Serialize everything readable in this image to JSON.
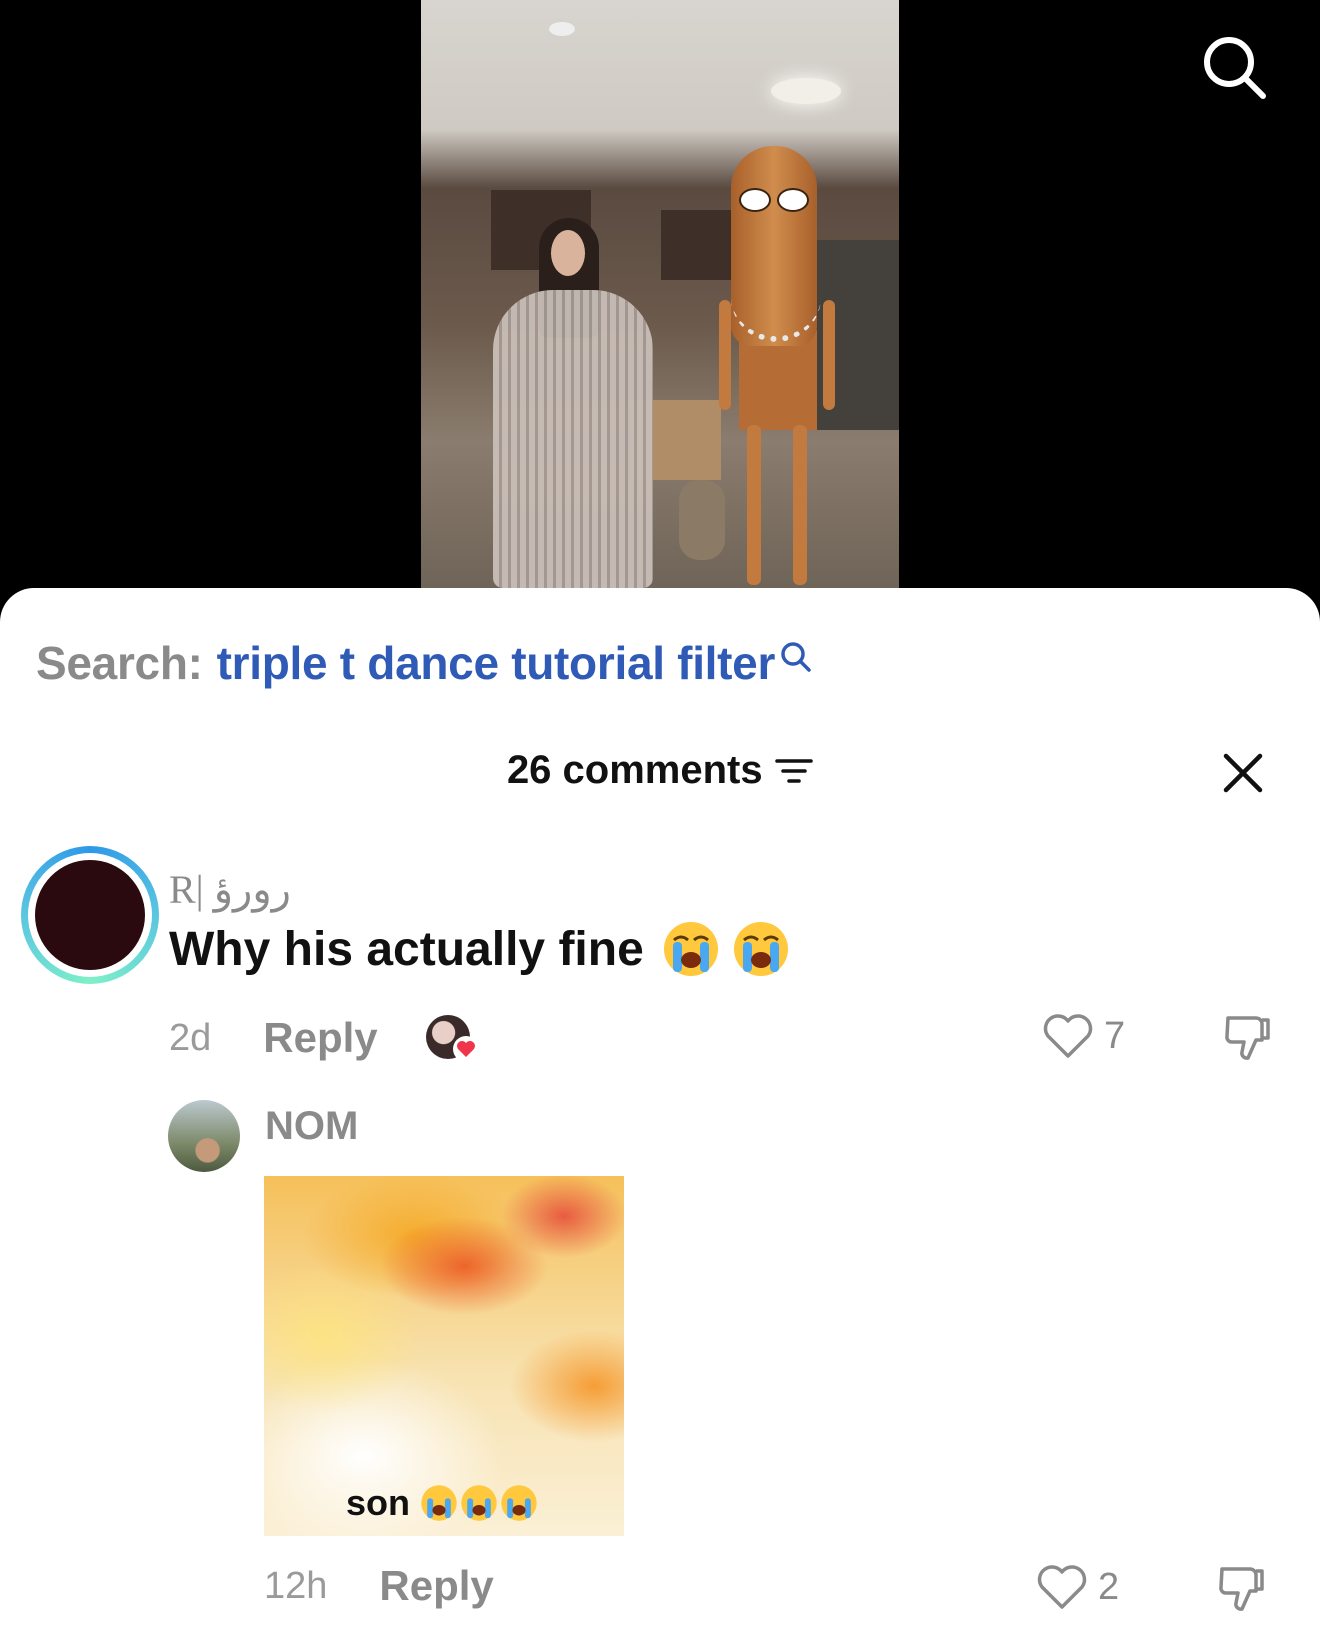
{
  "search_suggestion": {
    "label": "Search:",
    "term": "triple t dance tutorial filter"
  },
  "comments_header": {
    "count_label": "26 comments"
  },
  "comments": [
    {
      "username": "R| رورؤ",
      "text": "Why his actually fine",
      "emojis": [
        "loudly-crying-face",
        "loudly-crying-face"
      ],
      "time": "2d",
      "reply_label": "Reply",
      "likes": "7",
      "liked_by_creator": true
    },
    {
      "username": "NOM",
      "image_caption": "son",
      "image_caption_emojis": [
        "loudly-crying-face",
        "loudly-crying-face",
        "loudly-crying-face"
      ],
      "time": "12h",
      "reply_label": "Reply",
      "likes": "2"
    }
  ],
  "icons": {
    "top_search": "search-icon",
    "sort": "sort-icon",
    "close": "close-icon",
    "like": "heart-outline-icon",
    "dislike": "thumbs-down-icon"
  },
  "colors": {
    "search_term": "#2f5bb7",
    "muted_text": "#8a8a8a",
    "liked_heart": "#f0344a"
  }
}
